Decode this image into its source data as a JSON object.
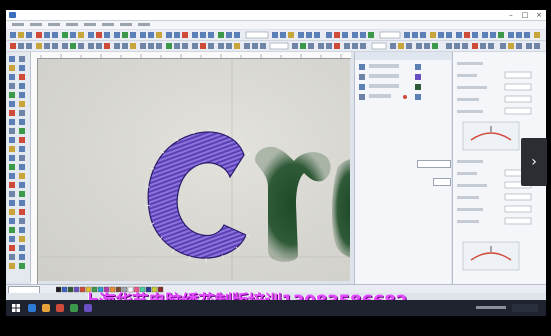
{
  "watermark": {
    "text": "上海华艺电脑绣花制版培训13083586682",
    "color": "#e24bff"
  },
  "colors": {
    "stitch_purple": "#6a4fc3",
    "stitch_green": "#2f5a38",
    "canvas_bg": "#d7d6d0",
    "taskbar_bg": "#1f2330"
  },
  "icons": {
    "next": "chevron-right-icon",
    "windows": "windows-start-icon"
  },
  "nav": {
    "next_glyph": "›"
  }
}
